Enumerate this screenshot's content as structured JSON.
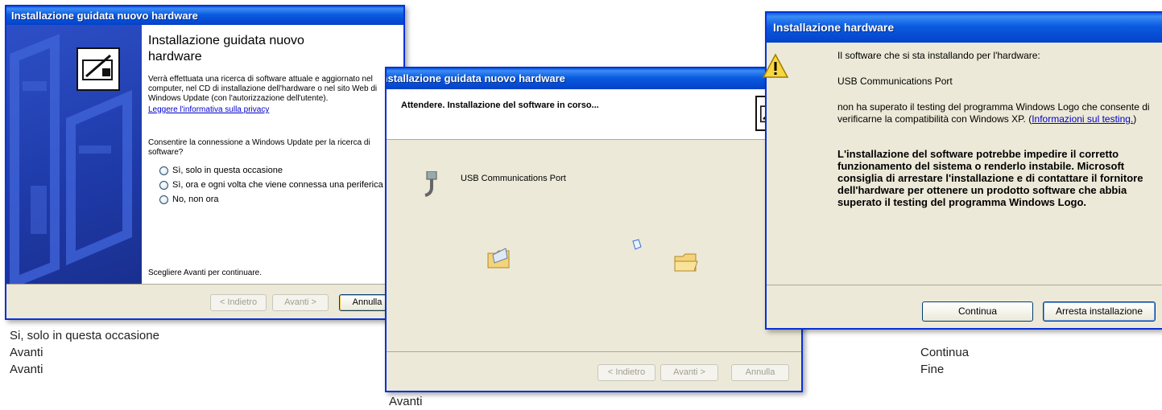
{
  "window1": {
    "title": "Installazione guidata nuovo hardware",
    "heading": "Installazione guidata nuovo hardware",
    "paragraph": "Verrà effettuata una ricerca di software attuale e aggiornato nel computer, nel CD di installazione dell'hardware o nel sito Web di Windows Update (con l'autorizzazione dell'utente).",
    "privacy_link": "Leggere l'informativa sulla privacy",
    "question": "Consentire la connessione a Windows Update per la ricerca di software?",
    "radios": [
      {
        "label": "Sì, solo in questa occasione",
        "selected": false
      },
      {
        "label": "Sì, ora e ogni volta che viene connessa una periferica",
        "selected": false
      },
      {
        "label": "No, non ora",
        "selected": false
      }
    ],
    "footer": "Scegliere Avanti per continuare.",
    "buttons": {
      "back": "< Indietro",
      "next": "Avanti >",
      "cancel": "Annulla"
    }
  },
  "window2": {
    "title": "Installazione guidata nuovo hardware",
    "heading": "Attendere. Installazione del software in corso...",
    "device": "USB Communications Port",
    "buttons": {
      "back": "< Indietro",
      "next": "Avanti >",
      "cancel": "Annulla"
    }
  },
  "window3": {
    "title": "Installazione hardware",
    "intro": "Il software che si sta installando per l'hardware:",
    "device": "USB Communications Port",
    "msg_before_link": "non ha superato il testing del programma Windows Logo che consente di verificarne la compatibilità con Windows XP. (",
    "link": "Informazioni sul testing.",
    "msg_after_link": ")",
    "warning": "L'installazione del software potrebbe impedire il corretto funzionamento del sistema o renderlo instabile. Microsoft consiglia di arrestare l'installazione e di contattare il fornitore dell'hardware per ottenere un prodotto software che abbia superato il testing del programma Windows Logo.",
    "buttons": {
      "continue": "Continua",
      "stop": "Arresta installazione"
    }
  },
  "captions": {
    "left": [
      "Si, solo in questa occasione",
      "Avanti",
      "Avanti"
    ],
    "middle": "Avanti",
    "right": [
      "Continua",
      "Fine"
    ]
  },
  "colors": {
    "titlebar": "#0a5be0",
    "accent": "#003c74",
    "link": "#0000cc"
  }
}
